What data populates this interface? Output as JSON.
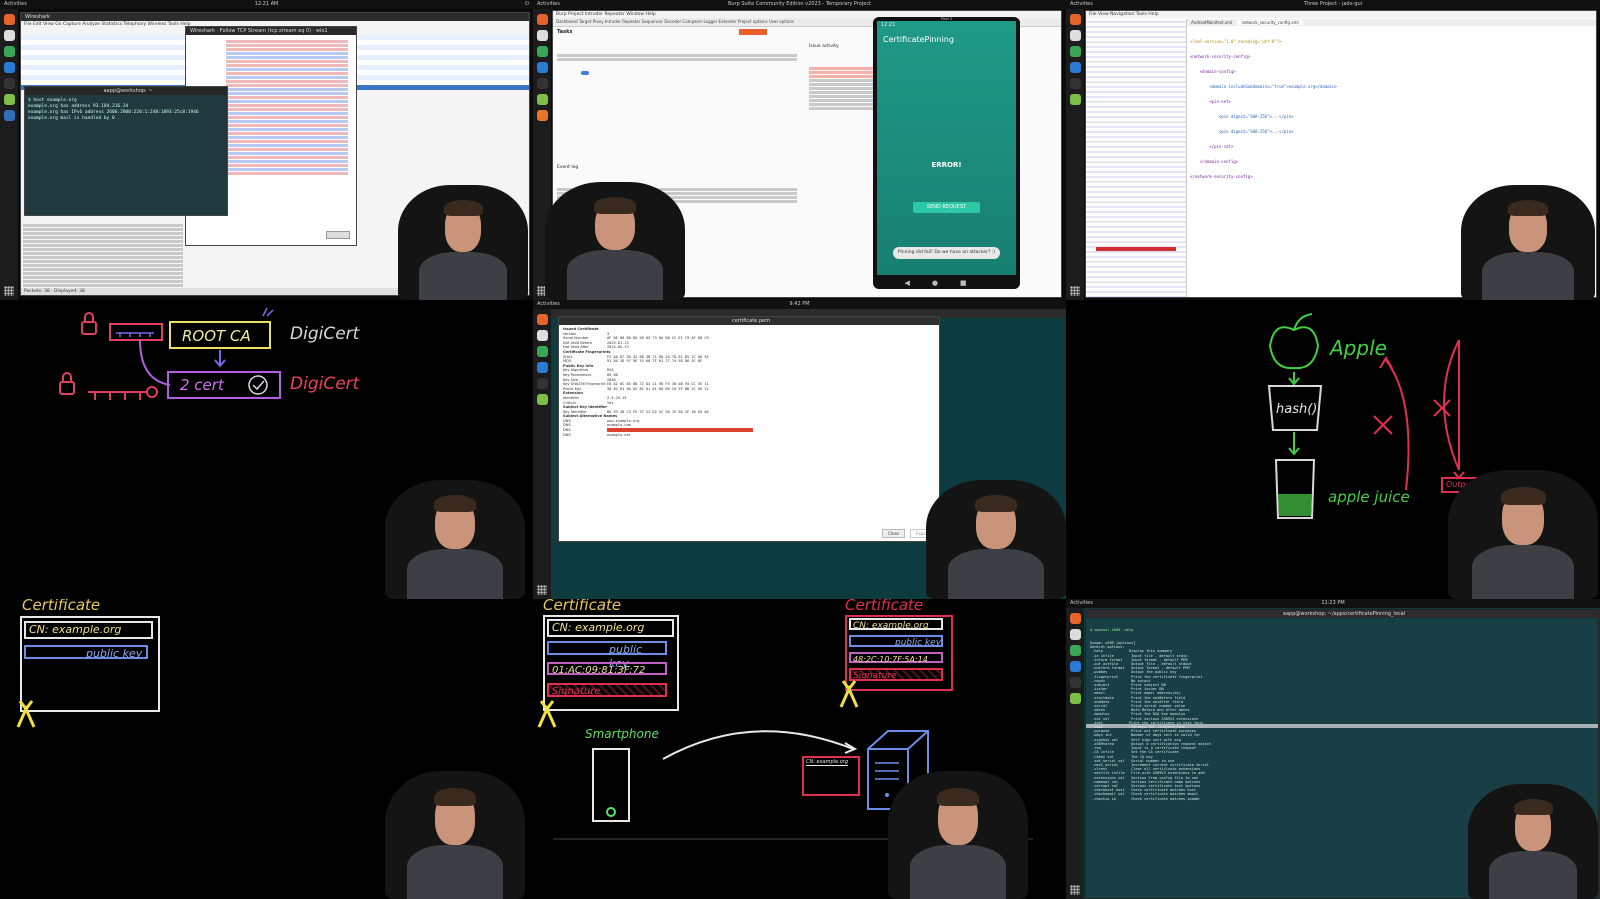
{
  "tile1": {
    "activities": "Activities",
    "terminal_title": "Terminal",
    "wireshark_title": "Wireshark · Follow TCP Stream (tcp.stream eq 0) · wlo1",
    "terminal_window_title": "aapp@workshop: ~",
    "terminal_lines": [
      "$ host example.org",
      "example.org has address 93.184.216.34",
      "example.org has IPv6 address 2606:2800:220:1:248:1893:25c8:1946",
      "example.org mail is handled by 0 ."
    ],
    "status": "Packets: 38 · Displayed: 38"
  },
  "tile2": {
    "burp_title": "Burp Suite Community Edition v2023 - Temporary Project",
    "tasks_label": "Tasks",
    "issue_activity": "Issue activity",
    "event_log": "Event log",
    "phone": {
      "time": "12:21",
      "window_title": "Pixel 3",
      "app_title": "CertificatePinning",
      "error": "ERROR!",
      "button": "SEND REQUEST",
      "toast": "Pinning did fail! Do we have an attacker? :)"
    }
  },
  "tile3": {
    "ide_title": "Three Project - jadx-gui",
    "tab1": "AndroidManifest.xml",
    "tab2": "network_security_config.xml",
    "code_lines": [
      "<?xml version=\"1.0\" encoding=\"utf-8\"?>",
      "<network-security-config>",
      "    <domain-config>",
      "        <domain includeSubdomains=\"true\">example.org</domain>",
      "        <pin-set>",
      "            <pin digest=\"SHA-256\">...</pin>",
      "            <pin digest=\"SHA-256\">...</pin>",
      "        </pin-set>",
      "    </domain-config>",
      "</network-security-config>"
    ]
  },
  "tile4": {
    "root_ca": "ROOT CA",
    "digicert1": "DigiCert",
    "cert2": "2 cert",
    "digicert2": "DigiCert"
  },
  "tile5": {
    "dialog_title": "certificate.pem",
    "fields": [
      {
        "k": "Issued Certificate",
        "v": ""
      },
      {
        "k": "Version",
        "v": "3"
      },
      {
        "k": "Serial Number",
        "v": "0F BE 08 B0 85 4D 05 73 8A B0 CC E1 C9 AF EB C9"
      },
      {
        "k": "Not Valid Before",
        "v": "2023-01-13"
      },
      {
        "k": "Not Valid After",
        "v": "2024-02-13"
      },
      {
        "k": "Certificate Fingerprints",
        "v": ""
      },
      {
        "k": "SHA1",
        "v": "F2 AA D7 3D 32 68 3B 71 6D 2A 7D 61 B5 1C 6D 54"
      },
      {
        "k": "MD5",
        "v": "91 8A 3D 97 9E 15 66 7F 01 27 74 5D D6 3C 8F"
      },
      {
        "k": "Public Key Info",
        "v": ""
      },
      {
        "k": "Key Algorithm",
        "v": "RSA"
      },
      {
        "k": "Key Parameters",
        "v": "05 00"
      },
      {
        "k": "Key Size",
        "v": "2048"
      },
      {
        "k": "Key SHA256 Fingerprint",
        "v": "E0 A2 0C 85 6B 72 D4 21 9D F5 30 08 F0 CC 3E 11"
      },
      {
        "k": "Public Key",
        "v": "30 82 01 0A 02 82 01 01 00 86 C6 3F 8B 2C 90 11"
      },
      {
        "k": "Extension",
        "v": ""
      },
      {
        "k": "Identifier",
        "v": "2.5.29.15"
      },
      {
        "k": "Critical",
        "v": "Yes"
      },
      {
        "k": "Subject Key Identifier",
        "v": ""
      },
      {
        "k": "Key Identifier",
        "v": "B0 93 30 C3 FE 37 23 D2 5C 9A 1E 0A 2F 1B 63 A6"
      },
      {
        "k": "Subject Alternative Names",
        "v": ""
      },
      {
        "k": "DNS",
        "v": "www.example.org"
      },
      {
        "k": "DNS",
        "v": "example.com"
      },
      {
        "k": "DNS",
        "v": "example.edu"
      },
      {
        "k": "DNS",
        "v": "example.net"
      }
    ],
    "close_btn": "Close",
    "export_btn": "Export"
  },
  "tile6": {
    "apple": "Apple",
    "hash": "hash()",
    "juice": "apple juice",
    "output": "Output"
  },
  "tile7": {
    "cert_heading": "Certificate",
    "cn": "CN: example.org",
    "pubkey": "public key"
  },
  "tile8": {
    "cert_heading": "Certificate",
    "cn": "CN: example.org",
    "pubkey": "public key",
    "fingerprint": "01:AC:09:81:3F:72",
    "signature": "Signature",
    "cert_heading2": "Certificate",
    "cn2": "CN: example.org",
    "pubkey2": "public key",
    "fingerprint2": "48:2C:10:7F:5A:14",
    "signature2": "Signature",
    "smartphone": "Smartphone",
    "cn_small": "CN: example.org"
  },
  "tile9": {
    "terminal_title": "aapp@workshop: ~/apps/certificatePinning_local",
    "cmd": "$ openssl x509 -help",
    "help_lines": [
      "Usage: x509 [options]",
      "General options:",
      " -help            Display this summary",
      " -in infile        Input file - default stdin",
      " -inform format    Input format - default PEM",
      " -out outfile      Output file - default stdout",
      " -outform format   Output format - default PEM",
      " -pubkey           Output the public key",
      " -fingerprint      Print the certificate fingerprint",
      " -noout            No output",
      " -subject          Print subject DN",
      " -issuer           Print issuer DN",
      " -email            Print email address(es)",
      " -startdate        Print the notBefore field",
      " -enddate          Print the notAfter field",
      " -serial           Print serial number value",
      " -dates            Both Before and After dates",
      " -modulus          Print the RSA key modulus",
      " -ext val          Print various X509V3 extensions",
      " -text            Print the certificate in text form",
      " -hash             Synonym for -subject_hash",
      " -purpose          Print out certificate purposes",
      " -days int         Number of days cert is valid for",
      " -signkey val      Self sign cert with arg",
      " -x509toreq        Output a certification request object",
      " -req              Input is a certificate request",
      " -CA infile        Set the CA certificate",
      " -CAkey val        The CA key",
      " -set_serial val   Serial number to use",
      " -next_serial      Increment current certificate serial",
      " -clrext           Clear all certificate extensions",
      " -extfile infile   File with X509V3 extensions to add",
      " -extensions val   Section from config file to use",
      " -nameopt val      Various certificate name options",
      " -certopt val      Various certificate text options",
      " -checkhost host   Check certificate matches host",
      " -checkemail val   Check certificate matches email",
      " -checkip ip       Check certificate matches ipaddr"
    ]
  }
}
